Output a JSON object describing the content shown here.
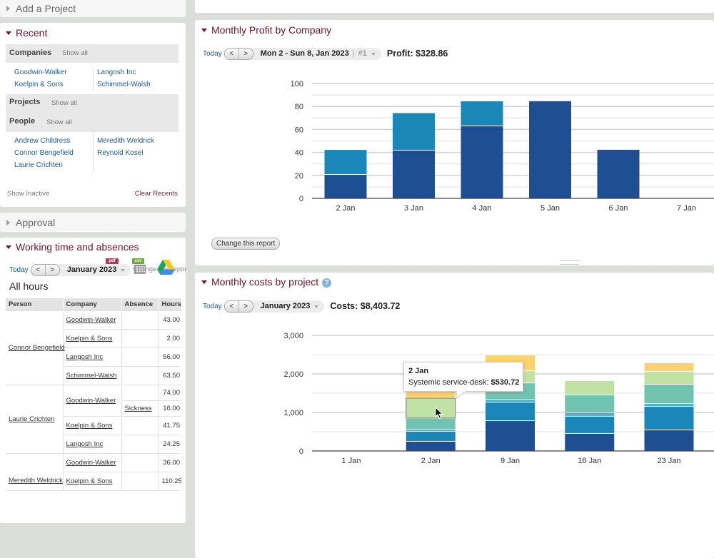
{
  "colors": {
    "accent": "#6b1526",
    "link": "#1f5a8c",
    "page_bg": "#dcdedc"
  },
  "left": {
    "add_project": {
      "title": "Add a Project"
    },
    "recent": {
      "title": "Recent",
      "companies": {
        "label": "Companies",
        "show_all": "Show all",
        "col1": [
          "Goodwin-Walker",
          "Koelpin & Sons"
        ],
        "col2": [
          "Langosh Inc",
          "Schimmel-Walsh"
        ]
      },
      "projects": {
        "label": "Projects",
        "show_all": "Show all"
      },
      "people": {
        "label": "People",
        "show_all": "Show all",
        "col1": [
          "Andrew Childress",
          "Connor Bengefield",
          "Laurie Crichten"
        ],
        "col2": [
          "Meredith Weldrick",
          "Reynold Kosel"
        ]
      },
      "show_inactive": "Show Inactive",
      "clear_recents": "Clear Recents"
    },
    "approval": {
      "title": "Approval"
    },
    "working_time": {
      "title": "Working time and absences",
      "toolbar": {
        "today": "Today",
        "prev": "<",
        "next": ">",
        "period": "January 2023"
      },
      "export_pdf": "pdf",
      "export_csv": "csv",
      "change_report": "Change this report",
      "subtitle": "All hours",
      "table": {
        "columns": [
          "Person",
          "Company",
          "Absence",
          "Hours"
        ],
        "groups": [
          {
            "person": "Connor Bengefield",
            "rows": [
              {
                "company": "Goodwin-Walker",
                "entries": [
                  {
                    "absence": "",
                    "hours": "43.00"
                  }
                ]
              },
              {
                "company": "Koelpin & Sons",
                "entries": [
                  {
                    "absence": "",
                    "hours": "2.00"
                  }
                ]
              },
              {
                "company": "Langosh Inc",
                "entries": [
                  {
                    "absence": "",
                    "hours": "56.00"
                  }
                ]
              },
              {
                "company": "Schimmel-Walsh",
                "entries": [
                  {
                    "absence": "",
                    "hours": "63.50"
                  }
                ]
              }
            ]
          },
          {
            "person": "Laurie Crichten",
            "rows": [
              {
                "company": "Goodwin-Walker",
                "entries": [
                  {
                    "absence": "",
                    "hours": "74.00"
                  },
                  {
                    "absence": "Sickness",
                    "hours": "16.00"
                  }
                ]
              },
              {
                "company": "Koelpin & Sons",
                "entries": [
                  {
                    "absence": "",
                    "hours": "41.75"
                  }
                ]
              },
              {
                "company": "Langosh Inc",
                "entries": [
                  {
                    "absence": "",
                    "hours": "24.25"
                  }
                ]
              }
            ]
          },
          {
            "person": "Meredith Weldrick",
            "rows": [
              {
                "company": "Goodwin-Walker",
                "entries": [
                  {
                    "absence": "",
                    "hours": "36.00"
                  }
                ]
              },
              {
                "company": "Koelpin & Sons",
                "entries": [
                  {
                    "absence": "",
                    "hours": "110.25"
                  }
                ]
              }
            ]
          }
        ]
      }
    }
  },
  "right": {
    "profit": {
      "title": "Monthly Profit by Company",
      "toolbar": {
        "today": "Today",
        "prev": "<",
        "next": ">",
        "period": "Mon 2 - Sun 8, Jan 2023",
        "period_separator": "|",
        "period_index": "#1"
      },
      "summary": "Profit: $328.86",
      "change_report": "Change this report"
    },
    "costs": {
      "title": "Monthly costs by project",
      "toolbar": {
        "today": "Today",
        "prev": "<",
        "next": ">",
        "period": "January 2023"
      },
      "summary": "Costs: $8,403.72",
      "tooltip": {
        "title": "2 Jan",
        "label": "Systemic service-desk:",
        "value": "$530.72"
      }
    }
  },
  "chart_data": [
    {
      "type": "bar",
      "stacked": true,
      "title": "Monthly Profit by Company",
      "xlabel": "",
      "ylabel": "",
      "categories": [
        "2 Jan",
        "3 Jan",
        "4 Jan",
        "5 Jan",
        "6 Jan",
        "7 Jan"
      ],
      "series": [
        {
          "name": null,
          "color": "#1f4f93",
          "values": [
            21.1,
            42.3,
            63.4,
            84.6,
            42.3,
            0
          ]
        },
        {
          "name": null,
          "color": "#1b86b8",
          "values": [
            21.1,
            31.9,
            21.1,
            0,
            0,
            0
          ]
        }
      ],
      "ylim": [
        0,
        100
      ],
      "yticks": [
        0,
        20,
        40,
        60,
        80,
        100
      ],
      "ytick_labels": [
        "0",
        "20",
        "40",
        "60",
        "80",
        "100"
      ],
      "minor_step": 10,
      "grid": true,
      "legend": "none"
    },
    {
      "type": "bar",
      "stacked": true,
      "title": "Monthly costs by project",
      "xlabel": "",
      "ylabel": "",
      "categories": [
        "1 Jan",
        "2 Jan",
        "9 Jan",
        "16 Jan",
        "23 Jan"
      ],
      "series": [
        {
          "name": null,
          "color": "#1f4f93",
          "values": [
            0,
            260,
            795,
            465,
            555
          ]
        },
        {
          "name": null,
          "color": "#1b86b8",
          "values": [
            0,
            260,
            480,
            445,
            610
          ]
        },
        {
          "name": null,
          "color": "#4cb0cc",
          "values": [
            0,
            55,
            75,
            90,
            75
          ]
        },
        {
          "name": null,
          "color": "#70c3ae",
          "values": [
            0,
            280,
            425,
            465,
            500
          ]
        },
        {
          "name": "Systemic service-desk",
          "color": "#c0e2a5",
          "values": [
            0,
            530.72,
            315,
            350,
            335
          ]
        },
        {
          "name": null,
          "color": "#fbd26f",
          "values": [
            0,
            190,
            390,
            0,
            205
          ]
        }
      ],
      "ylim": [
        0,
        3000
      ],
      "yticks": [
        0,
        1000,
        2000,
        3000
      ],
      "ytick_labels": [
        "0",
        "1,000",
        "2,000",
        "3,000"
      ],
      "minor_step": 500,
      "grid": true,
      "legend": "none",
      "highlight": {
        "category": "2 Jan",
        "series": "Systemic service-desk"
      }
    }
  ]
}
